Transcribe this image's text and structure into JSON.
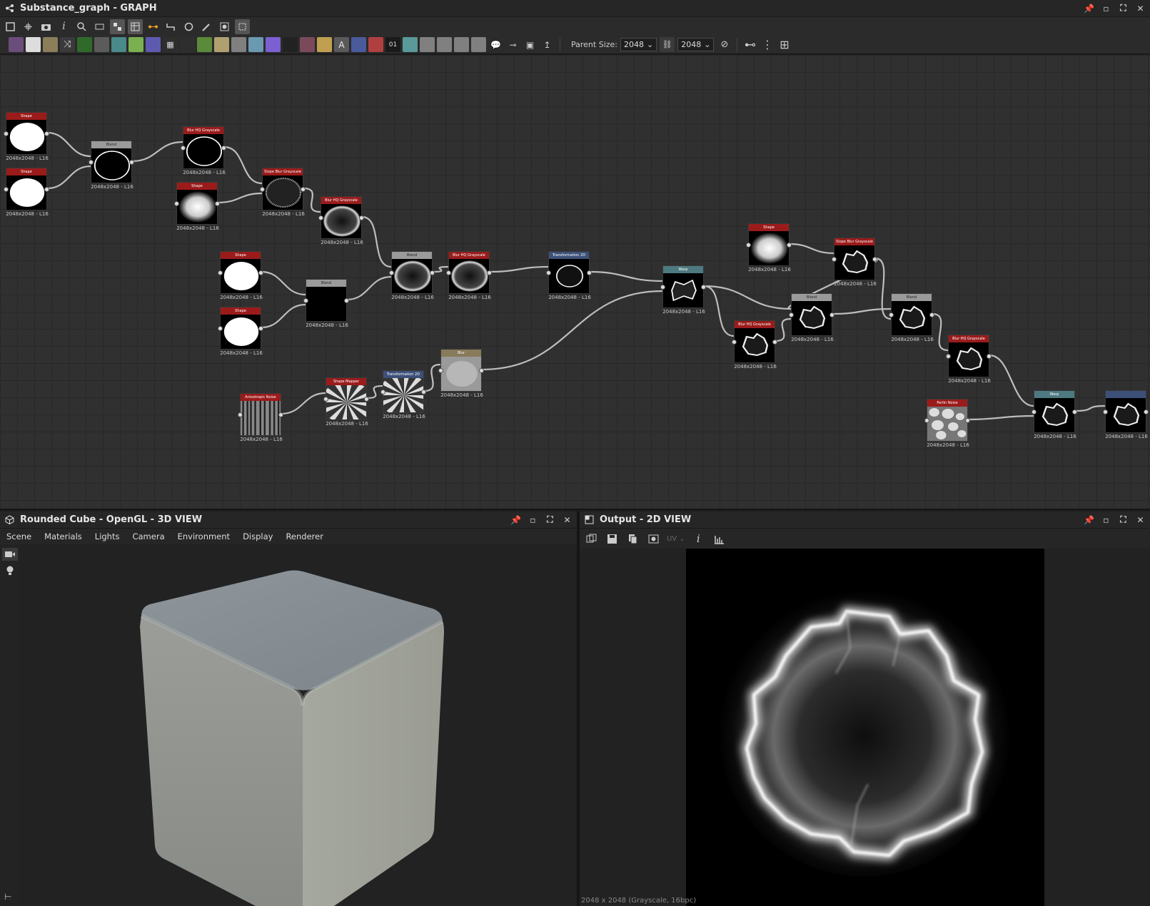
{
  "graph": {
    "title": "Substance_graph - GRAPH",
    "parent_size_label": "Parent Size:",
    "parent_size_value": "2048",
    "height_value": "2048"
  },
  "nodes": [
    {
      "id": "n1",
      "title": "Shape",
      "color": "red",
      "label": "2048x2048 - L16",
      "thumb": "disc"
    },
    {
      "id": "n2",
      "title": "Shape",
      "color": "red",
      "label": "2048x2048 - L16",
      "thumb": "disc"
    },
    {
      "id": "n3",
      "title": "Blend",
      "color": "gray",
      "label": "2048x2048 - L16",
      "thumb": "ring"
    },
    {
      "id": "n4",
      "title": "Blur HQ Grayscale",
      "color": "red",
      "label": "2048x2048 - L16",
      "thumb": "ring"
    },
    {
      "id": "n5",
      "title": "Shape",
      "color": "red",
      "label": "2048x2048 - L16",
      "thumb": "soft"
    },
    {
      "id": "n6",
      "title": "Slope Blur Grayscale",
      "color": "red",
      "label": "2048x2048 - L16",
      "thumb": "fuzzy"
    },
    {
      "id": "n7",
      "title": "Blur HQ Grayscale",
      "color": "red",
      "label": "2048x2048 - L16",
      "thumb": "glowring"
    },
    {
      "id": "n8",
      "title": "Shape",
      "color": "red",
      "label": "2048x2048 - L16",
      "thumb": "disc"
    },
    {
      "id": "n9",
      "title": "Shape",
      "color": "red",
      "label": "2048x2048 - L16",
      "thumb": "disc"
    },
    {
      "id": "n10",
      "title": "Blend",
      "color": "gray",
      "label": "2048x2048 - L16",
      "thumb": "black"
    },
    {
      "id": "n11",
      "title": "Blend",
      "color": "gray",
      "label": "2048x2048 - L16",
      "thumb": "glowring"
    },
    {
      "id": "n12",
      "title": "Blur HQ Grayscale",
      "color": "red",
      "label": "2048x2048 - L16",
      "thumb": "glowring"
    },
    {
      "id": "n13",
      "title": "Transformation 2D",
      "color": "blue",
      "label": "2048x2048 - L16",
      "thumb": "thinring"
    },
    {
      "id": "n14",
      "title": "Warp",
      "color": "teal",
      "label": "2048x2048 - L16",
      "thumb": "warp"
    },
    {
      "id": "n15",
      "title": "Anisotropic Noise",
      "color": "red",
      "label": "2048x2048 - L16",
      "thumb": "stripes"
    },
    {
      "id": "n16",
      "title": "Shape Mapper",
      "color": "red",
      "label": "2048x2048 - L16",
      "thumb": "rays"
    },
    {
      "id": "n17",
      "title": "Transformation 2D",
      "color": "blue",
      "label": "2048x2048 - L16",
      "thumb": "rays"
    },
    {
      "id": "n18",
      "title": "Blur",
      "color": "tan",
      "label": "2048x2048 - L16",
      "thumb": "softrays"
    },
    {
      "id": "n19",
      "title": "Shape",
      "color": "red",
      "label": "2048x2048 - L16",
      "thumb": "soft"
    },
    {
      "id": "n20",
      "title": "Slope Blur Grayscale",
      "color": "red",
      "label": "2048x2048 - L16",
      "thumb": "fire"
    },
    {
      "id": "n21",
      "title": "Blur HQ Grayscale",
      "color": "red",
      "label": "2048x2048 - L16",
      "thumb": "fire"
    },
    {
      "id": "n22",
      "title": "Blend",
      "color": "gray",
      "label": "2048x2048 - L16",
      "thumb": "fire"
    },
    {
      "id": "n23",
      "title": "Blend",
      "color": "gray",
      "label": "2048x2048 - L16",
      "thumb": "fire"
    },
    {
      "id": "n24",
      "title": "Blur HQ Grayscale",
      "color": "red",
      "label": "2048x2048 - L16",
      "thumb": "fire"
    },
    {
      "id": "n25",
      "title": "Perlin Noise",
      "color": "red",
      "label": "2048x2048 - L16",
      "thumb": "noise"
    },
    {
      "id": "n26",
      "title": "Warp",
      "color": "teal",
      "label": "2048x2048 - L16",
      "thumb": "fire"
    },
    {
      "id": "n27",
      "title": "",
      "color": "blue",
      "label": "2048x2048 - L16",
      "thumb": "fire"
    }
  ],
  "view3d": {
    "title": "Rounded Cube - OpenGL - 3D VIEW",
    "menu": [
      "Scene",
      "Materials",
      "Lights",
      "Camera",
      "Environment",
      "Display",
      "Renderer"
    ]
  },
  "view2d": {
    "title": "Output - 2D VIEW",
    "uv_label": "UV",
    "status": "2048 x 2048 (Grayscale, 16bpc)"
  },
  "icons": {
    "graph": "graph-icon",
    "cube": "cube-icon",
    "view2d": "view2d-icon",
    "pin": "pin-icon",
    "float": "float-icon",
    "maximize": "maximize-icon",
    "close": "close-icon"
  }
}
